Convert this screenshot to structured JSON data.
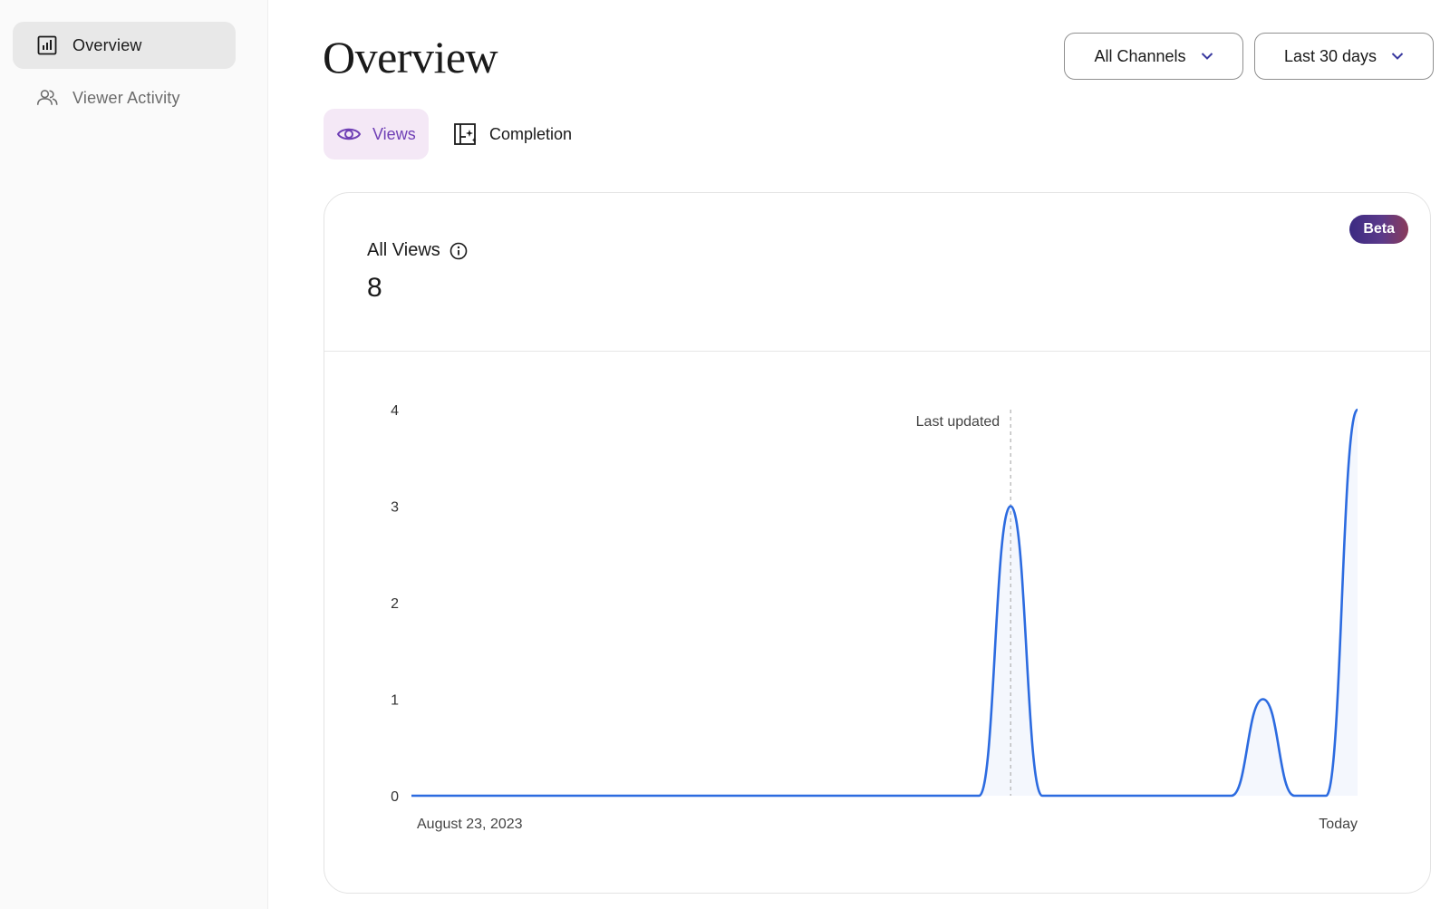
{
  "sidebar": {
    "items": [
      {
        "label": "Overview",
        "icon": "bar-chart-icon",
        "active": true
      },
      {
        "label": "Viewer Activity",
        "icon": "users-icon",
        "active": false
      }
    ]
  },
  "header": {
    "title": "Overview",
    "channel_filter": "All Channels",
    "date_filter": "Last 30 days"
  },
  "tabs": [
    {
      "label": "Views",
      "icon": "eye-icon",
      "active": true
    },
    {
      "label": "Completion",
      "icon": "completion-icon",
      "active": false
    }
  ],
  "card": {
    "badge": "Beta",
    "metric_label": "All Views",
    "metric_value": "8"
  },
  "colors": {
    "accent": "#6f3fb5",
    "line": "#2c6be0",
    "tab_active_bg": "#f4e8f6"
  },
  "chart_data": {
    "type": "line",
    "x_start_label": "August 23, 2023",
    "x_end_label": "Today",
    "ylim": [
      0,
      4
    ],
    "y_ticks": [
      0,
      1,
      2,
      3,
      4
    ],
    "marker_label": "Last updated",
    "marker_index": 19,
    "x_count": 30,
    "values": [
      0,
      0,
      0,
      0,
      0,
      0,
      0,
      0,
      0,
      0,
      0,
      0,
      0,
      0,
      0,
      0,
      0,
      0,
      0,
      3,
      0,
      0,
      0,
      0,
      0,
      0,
      0,
      1,
      0,
      0,
      4
    ]
  }
}
